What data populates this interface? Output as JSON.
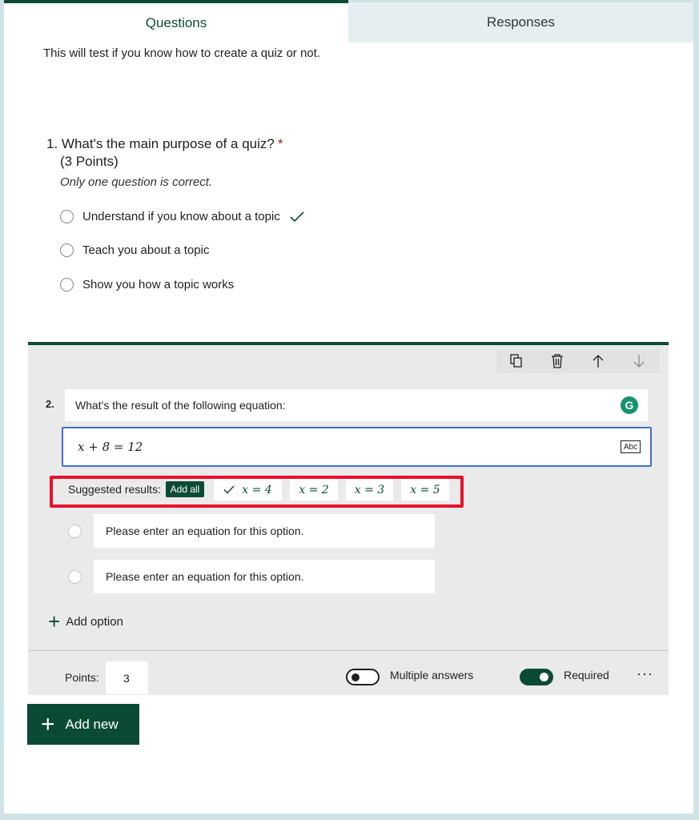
{
  "tabs": {
    "questions": "Questions",
    "responses": "Responses"
  },
  "form": {
    "description": "This will test if you know how to create a quiz or not."
  },
  "question1": {
    "title": "1. What's the main purpose of a quiz?",
    "required_mark": "*",
    "points": "(3 Points)",
    "hint": "Only one question is correct.",
    "options": [
      "Understand if you know about a topic",
      "Teach you about a topic",
      "Show you how a topic works"
    ],
    "correct_index": 0
  },
  "question2": {
    "number": "2.",
    "title": "What's the result of the following equation:",
    "equation": "x + 8 = 12",
    "equation_mode_badge": "Abc",
    "suggested_label": "Suggested results:",
    "add_all": "Add all",
    "suggestions": [
      "x = 4",
      "x = 2",
      "x = 3",
      "x = 5"
    ],
    "option_placeholder": "Please enter an equation for this option.",
    "add_option": "Add option",
    "points_label": "Points:",
    "points_value": "3",
    "multiple_answers_label": "Multiple answers",
    "multiple_answers_on": false,
    "required_label": "Required",
    "required_on": true,
    "more": "···"
  },
  "add_new": "Add new",
  "colors": {
    "brand": "#0b4b33",
    "highlight_box": "#e8112d",
    "focus_border": "#3d6fd8",
    "required": "#a4262c"
  },
  "icons": {
    "toolbar": [
      "copy-icon",
      "trash-icon",
      "arrow-up-icon",
      "arrow-down-icon"
    ]
  }
}
